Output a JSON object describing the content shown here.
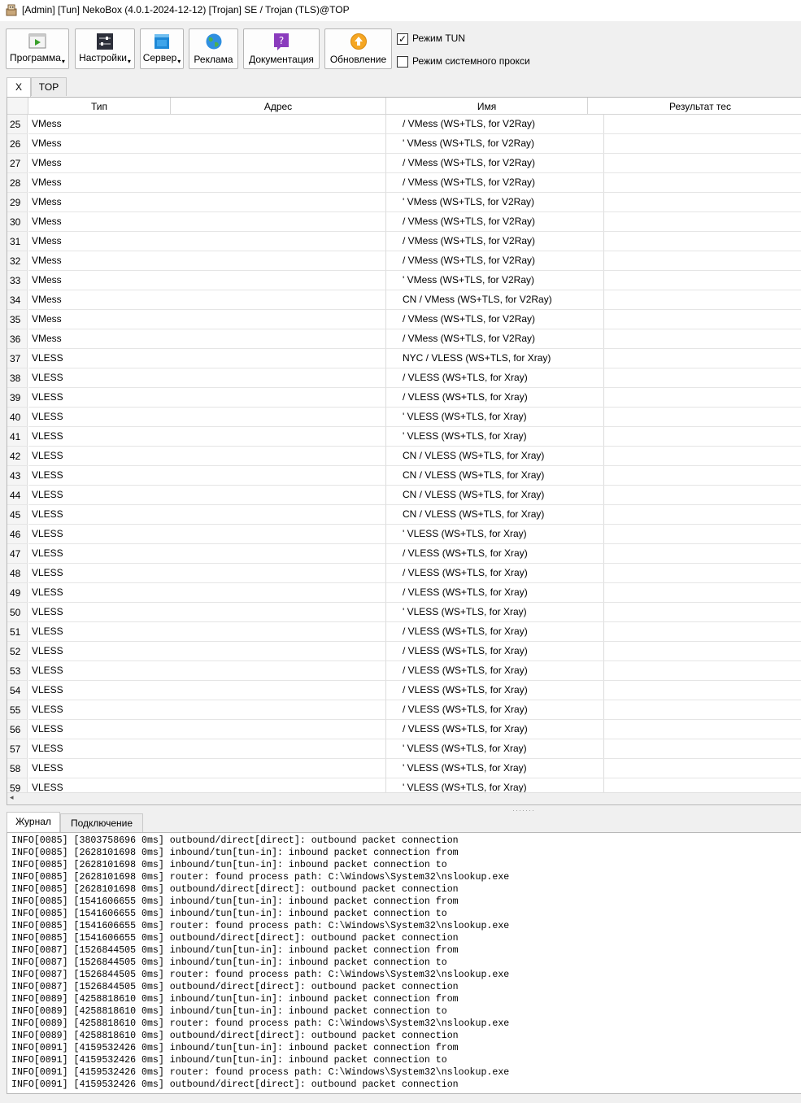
{
  "window": {
    "title": "[Admin] [Tun] NekoBox (4.0.1-2024-12-12) [Trojan] SE / Trojan (TLS)@TOP",
    "app_icon": "nekobox-app-icon"
  },
  "toolbar": {
    "buttons": [
      {
        "label": "Программа",
        "icon": "play-icon",
        "has_menu": true
      },
      {
        "label": "Настройки",
        "icon": "sliders-icon",
        "has_menu": true
      },
      {
        "label": "Сервер",
        "icon": "server-window-icon",
        "has_menu": true
      },
      {
        "label": "Реклама",
        "icon": "globe-icon",
        "has_menu": false
      },
      {
        "label": "Документация",
        "icon": "help-icon",
        "has_menu": false
      },
      {
        "label": "Обновление",
        "icon": "update-icon",
        "has_menu": false
      }
    ],
    "tun_mode": {
      "label": "Режим TUN",
      "checked": true
    },
    "system_proxy": {
      "label": "Режим системного прокси",
      "checked": false
    }
  },
  "group_tabs": [
    {
      "label": "X",
      "active": true
    },
    {
      "label": "TOP",
      "active": false
    }
  ],
  "table": {
    "headers": [
      "Тип",
      "Адрес",
      "Имя",
      "Результат тес"
    ],
    "rows": [
      {
        "n": "25",
        "type": "VMess",
        "name": "/ VMess (WS+TLS, for V2Ray)"
      },
      {
        "n": "26",
        "type": "VMess",
        "name": "' VMess (WS+TLS, for V2Ray)"
      },
      {
        "n": "27",
        "type": "VMess",
        "name": "/ VMess (WS+TLS, for V2Ray)"
      },
      {
        "n": "28",
        "type": "VMess",
        "name": "/ VMess (WS+TLS, for V2Ray)"
      },
      {
        "n": "29",
        "type": "VMess",
        "name": "' VMess (WS+TLS, for V2Ray)"
      },
      {
        "n": "30",
        "type": "VMess",
        "name": "/ VMess (WS+TLS, for V2Ray)"
      },
      {
        "n": "31",
        "type": "VMess",
        "name": "/ VMess (WS+TLS, for V2Ray)"
      },
      {
        "n": "32",
        "type": "VMess",
        "name": "/ VMess (WS+TLS, for V2Ray)"
      },
      {
        "n": "33",
        "type": "VMess",
        "name": "' VMess (WS+TLS, for V2Ray)"
      },
      {
        "n": "34",
        "type": "VMess",
        "name": "CN / VMess (WS+TLS, for V2Ray)"
      },
      {
        "n": "35",
        "type": "VMess",
        "name": "/ VMess (WS+TLS, for V2Ray)"
      },
      {
        "n": "36",
        "type": "VMess",
        "name": "/ VMess (WS+TLS, for V2Ray)"
      },
      {
        "n": "37",
        "type": "VLESS",
        "name": "NYC / VLESS (WS+TLS, for Xray)"
      },
      {
        "n": "38",
        "type": "VLESS",
        "name": "/ VLESS (WS+TLS, for Xray)"
      },
      {
        "n": "39",
        "type": "VLESS",
        "name": "/ VLESS (WS+TLS, for Xray)"
      },
      {
        "n": "40",
        "type": "VLESS",
        "name": "' VLESS (WS+TLS, for Xray)"
      },
      {
        "n": "41",
        "type": "VLESS",
        "name": "' VLESS (WS+TLS, for Xray)"
      },
      {
        "n": "42",
        "type": "VLESS",
        "name": "CN / VLESS (WS+TLS, for Xray)"
      },
      {
        "n": "43",
        "type": "VLESS",
        "name": "CN / VLESS (WS+TLS, for Xray)"
      },
      {
        "n": "44",
        "type": "VLESS",
        "name": "CN / VLESS (WS+TLS, for Xray)"
      },
      {
        "n": "45",
        "type": "VLESS",
        "name": "CN / VLESS (WS+TLS, for Xray)"
      },
      {
        "n": "46",
        "type": "VLESS",
        "name": "' VLESS (WS+TLS, for Xray)"
      },
      {
        "n": "47",
        "type": "VLESS",
        "name": "/ VLESS (WS+TLS, for Xray)"
      },
      {
        "n": "48",
        "type": "VLESS",
        "name": "/ VLESS (WS+TLS, for Xray)"
      },
      {
        "n": "49",
        "type": "VLESS",
        "name": "/ VLESS (WS+TLS, for Xray)"
      },
      {
        "n": "50",
        "type": "VLESS",
        "name": "' VLESS (WS+TLS, for Xray)"
      },
      {
        "n": "51",
        "type": "VLESS",
        "name": "/ VLESS (WS+TLS, for Xray)"
      },
      {
        "n": "52",
        "type": "VLESS",
        "name": "/ VLESS (WS+TLS, for Xray)"
      },
      {
        "n": "53",
        "type": "VLESS",
        "name": "/ VLESS (WS+TLS, for Xray)"
      },
      {
        "n": "54",
        "type": "VLESS",
        "name": "/ VLESS (WS+TLS, for Xray)"
      },
      {
        "n": "55",
        "type": "VLESS",
        "name": "/ VLESS (WS+TLS, for Xray)"
      },
      {
        "n": "56",
        "type": "VLESS",
        "name": "/ VLESS (WS+TLS, for Xray)"
      },
      {
        "n": "57",
        "type": "VLESS",
        "name": "' VLESS (WS+TLS, for Xray)"
      },
      {
        "n": "58",
        "type": "VLESS",
        "name": "' VLESS (WS+TLS, for Xray)"
      },
      {
        "n": "59",
        "type": "VLESS",
        "name": "' VLESS (WS+TLS, for Xray)"
      }
    ]
  },
  "bottom_tabs": [
    {
      "label": "Журнал",
      "active": true
    },
    {
      "label": "Подключение",
      "active": false
    }
  ],
  "log": [
    "INFO[0085] [3803758696 0ms] outbound/direct[direct]: outbound packet connection",
    "INFO[0085] [2628101698 0ms] inbound/tun[tun-in]: inbound packet connection from",
    "INFO[0085] [2628101698 0ms] inbound/tun[tun-in]: inbound packet connection to",
    "INFO[0085] [2628101698 0ms] router: found process path: C:\\Windows\\System32\\nslookup.exe",
    "INFO[0085] [2628101698 0ms] outbound/direct[direct]: outbound packet connection",
    "INFO[0085] [1541606655 0ms] inbound/tun[tun-in]: inbound packet connection from",
    "INFO[0085] [1541606655 0ms] inbound/tun[tun-in]: inbound packet connection to",
    "INFO[0085] [1541606655 0ms] router: found process path: C:\\Windows\\System32\\nslookup.exe",
    "INFO[0085] [1541606655 0ms] outbound/direct[direct]: outbound packet connection",
    "INFO[0087] [1526844505 0ms] inbound/tun[tun-in]: inbound packet connection from",
    "INFO[0087] [1526844505 0ms] inbound/tun[tun-in]: inbound packet connection to",
    "INFO[0087] [1526844505 0ms] router: found process path: C:\\Windows\\System32\\nslookup.exe",
    "INFO[0087] [1526844505 0ms] outbound/direct[direct]: outbound packet connection",
    "INFO[0089] [4258818610 0ms] inbound/tun[tun-in]: inbound packet connection from",
    "INFO[0089] [4258818610 0ms] inbound/tun[tun-in]: inbound packet connection to",
    "INFO[0089] [4258818610 0ms] router: found process path: C:\\Windows\\System32\\nslookup.exe",
    "INFO[0089] [4258818610 0ms] outbound/direct[direct]: outbound packet connection",
    "INFO[0091] [4159532426 0ms] inbound/tun[tun-in]: inbound packet connection from",
    "INFO[0091] [4159532426 0ms] inbound/tun[tun-in]: inbound packet connection to",
    "INFO[0091] [4159532426 0ms] router: found process path: C:\\Windows\\System32\\nslookup.exe",
    "INFO[0091] [4159532426 0ms] outbound/direct[direct]: outbound packet connection"
  ]
}
